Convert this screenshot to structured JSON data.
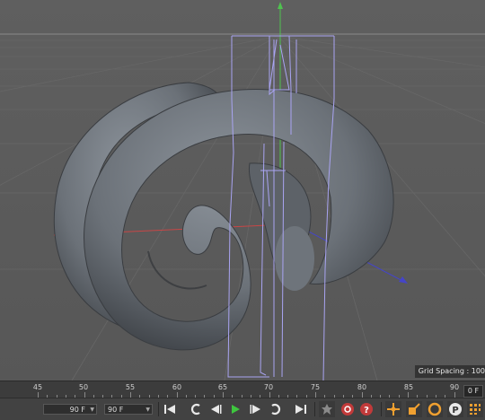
{
  "viewport": {
    "grid_spacing_label": "Grid Spacing : 100"
  },
  "timeline": {
    "ticks": [
      "45",
      "50",
      "55",
      "60",
      "65",
      "70",
      "75",
      "80",
      "85",
      "90"
    ],
    "current_frame": "0 F"
  },
  "transport": {
    "min_frame": "90 F",
    "max_frame": "90 F",
    "icons": [
      "go-to-start-icon",
      "step-back-icon",
      "play-backward-icon",
      "play-forward-icon",
      "step-forward-icon",
      "go-to-end-icon",
      "record-icon",
      "autokey-icon",
      "keyframe-help-icon",
      "move-key-icon",
      "scale-key-icon",
      "rotate-key-icon",
      "param-key-icon",
      "point-level-icon"
    ]
  },
  "colors": {
    "viewport_bg": "#5b5b5b",
    "torus": "#7d848c",
    "bbox_lines": "#a9a4f2",
    "x_axis": "#c84646",
    "y_axis": "#4fc24f",
    "z_axis": "#4545c8"
  }
}
